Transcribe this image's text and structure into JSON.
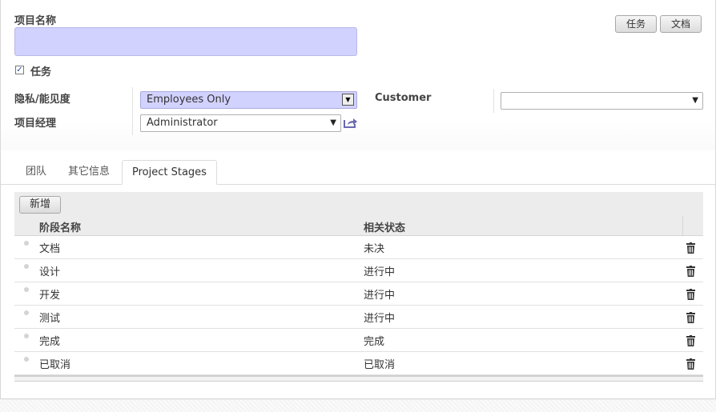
{
  "form": {
    "project_name_label": "项目名称",
    "project_name_value": "",
    "tasks_label": "任务",
    "tasks_checked": true,
    "privacy_label": "隐私/能见度",
    "privacy_value": "Employees Only",
    "manager_label": "项目经理",
    "manager_value": "Administrator",
    "customer_label": "Customer",
    "customer_value": ""
  },
  "buttons": {
    "tasks": "任务",
    "documents": "文档"
  },
  "tabs": [
    {
      "label": "团队",
      "active": false
    },
    {
      "label": "其它信息",
      "active": false
    },
    {
      "label": "Project Stages",
      "active": true
    }
  ],
  "stages": {
    "add_button": "新增",
    "columns": [
      "阶段名称",
      "相关状态"
    ],
    "rows": [
      {
        "name": "文档",
        "state": "未决"
      },
      {
        "name": "设计",
        "state": "进行中"
      },
      {
        "name": "开发",
        "state": "进行中"
      },
      {
        "name": "测试",
        "state": "进行中"
      },
      {
        "name": "完成",
        "state": "完成"
      },
      {
        "name": "已取消",
        "state": "已取消"
      }
    ]
  },
  "colors": {
    "required_field_bg": "#d2d2ff",
    "header_bg": "#ececec",
    "link_icon": "#6a6ab0"
  }
}
